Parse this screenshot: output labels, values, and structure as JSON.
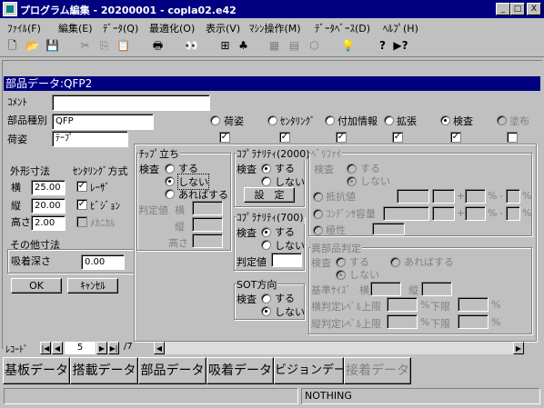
{
  "window": {
    "title": "プログラム編集 - 20200001 - copla02.e42",
    "buttons": {
      "minimize": "_",
      "maximize": "□",
      "close": "X"
    }
  },
  "menu": [
    "ﾌｧｲﾙ(F)",
    "編集(E)",
    "ﾃﾞｰﾀ(Q)",
    "最適化(O)",
    "表示(V)",
    "ﾏｼﾝ操作(M)",
    "ﾃﾞｰﾀﾍﾞｰｽ(D)",
    "ﾍﾙﾌﾟ(H)"
  ],
  "toolbar": {
    "icons": [
      "new-file-icon",
      "open-folder-icon",
      "save-icon",
      "cut-icon",
      "copy-icon",
      "paste-icon",
      "print-icon",
      "binoculars-icon",
      "network-icon",
      "components-icon",
      "grid-icon",
      "pattern-icon",
      "cube-icon",
      "lightbulb-icon",
      "help-icon",
      "context-help-icon"
    ],
    "glyphs": [
      "🗋",
      "📂",
      "💾",
      "✂",
      "⎘",
      "📋",
      "🖶",
      "👀",
      "⊞",
      "♣",
      "▦",
      "▤",
      "⬡",
      "💡",
      "?",
      "▶?"
    ]
  },
  "form": {
    "title": "部品データ:QFP2",
    "comment_label": "ｺﾒﾝﾄ",
    "comment_value": "",
    "part_type_label": "部品種別",
    "part_type_value": "QFP",
    "package_label": "荷姿",
    "package_value": "ﾃｰﾌﾟ",
    "view_options": [
      {
        "label": "荷姿",
        "selected": false,
        "enabled": true,
        "checked": true
      },
      {
        "label": "ｾﾝﾀﾘﾝｸﾞ",
        "selected": false,
        "enabled": true,
        "checked": true
      },
      {
        "label": "付加情報",
        "selected": false,
        "enabled": true,
        "checked": true
      },
      {
        "label": "拡張",
        "selected": false,
        "enabled": true,
        "checked": true
      },
      {
        "label": "検査",
        "selected": true,
        "enabled": true,
        "checked": true
      },
      {
        "label": "塗布",
        "selected": false,
        "enabled": false,
        "checked": false
      }
    ],
    "outer_dims": {
      "title": "外形寸法",
      "width_label": "横",
      "width_value": "25.00",
      "length_label": "縦",
      "length_value": "20.00",
      "height_label": "高さ",
      "height_value": "2.00"
    },
    "centering": {
      "title": "ｾﾝﾀﾘﾝｸﾞ方式",
      "items": [
        {
          "label": "ﾚｰｻﾞ",
          "checked": true,
          "enabled": true
        },
        {
          "label": "ﾋﾞｼﾞｮﾝ",
          "checked": true,
          "enabled": true
        },
        {
          "label": "ﾒｶﾆｶﾙ",
          "checked": false,
          "enabled": false
        }
      ]
    },
    "other_dims": {
      "title": "その他寸法",
      "suction_depth_label": "吸着深さ",
      "suction_depth_value": "0.00"
    },
    "ok_label": "OK",
    "cancel_label": "ｷｬﾝｾﾙ",
    "chip_stand": {
      "title": "ﾁｯﾌﾟ立ち",
      "inspect_label": "検査",
      "options": [
        "する",
        "しない",
        "あればする"
      ],
      "selected": 1,
      "judge_label": "判定値",
      "width_label": "横",
      "length_label": "縦",
      "height_label": "高さ"
    },
    "coplanarity2000": {
      "title": "ｺﾌﾟﾗﾅﾘﾃｨ(2000)",
      "inspect_label": "検査",
      "options": [
        "する",
        "しない"
      ],
      "selected": 0,
      "set_button": "設　定"
    },
    "coplanarity700": {
      "title": "ｺﾌﾟﾗﾅﾘﾃｨ(700)",
      "inspect_label": "検査",
      "options": [
        "する",
        "しない"
      ],
      "selected": 0,
      "judge_label": "判定値"
    },
    "sot_direction": {
      "title": "SOT方向",
      "inspect_label": "検査",
      "options": [
        "する",
        "しない"
      ],
      "selected": 1
    },
    "verify": {
      "title": "ﾍﾞﾘﾌｧｲ",
      "inspect_label": "検査",
      "options": [
        "する",
        "しない"
      ],
      "selected": 1,
      "resistance_label": "抵抗値",
      "capacitance_label": "ｺﾝﾃﾞﾝｻ容量",
      "polarity_label": "極性",
      "plus": "+",
      "minus": "-",
      "percent": "%"
    },
    "foreign_part": {
      "title": "異部品判定",
      "inspect_label": "検査",
      "options": [
        "する",
        "あればする",
        "しない"
      ],
      "selected": 2,
      "base_size_label": "基準ｻｲｽﾞ",
      "width_label": "横",
      "length_label": "縦",
      "width_judge_label": "横判定ﾚﾍﾞﾙ上限",
      "length_judge_label": "縦判定ﾚﾍﾞﾙ上限",
      "lower_label": "下限",
      "percent": "%"
    }
  },
  "record_nav": {
    "label": "ﾚｺｰﾄﾞ",
    "current": "5",
    "total": "/7"
  },
  "tabs": [
    {
      "label": "基板データ",
      "enabled": true
    },
    {
      "label": "搭載データ",
      "enabled": true
    },
    {
      "label": "部品データ",
      "enabled": true
    },
    {
      "label": "吸着データ",
      "enabled": true
    },
    {
      "label": "ビジョンデータ",
      "enabled": true
    },
    {
      "label": "接着データ",
      "enabled": false
    }
  ],
  "status": {
    "left": "",
    "right": "NOTHING"
  }
}
